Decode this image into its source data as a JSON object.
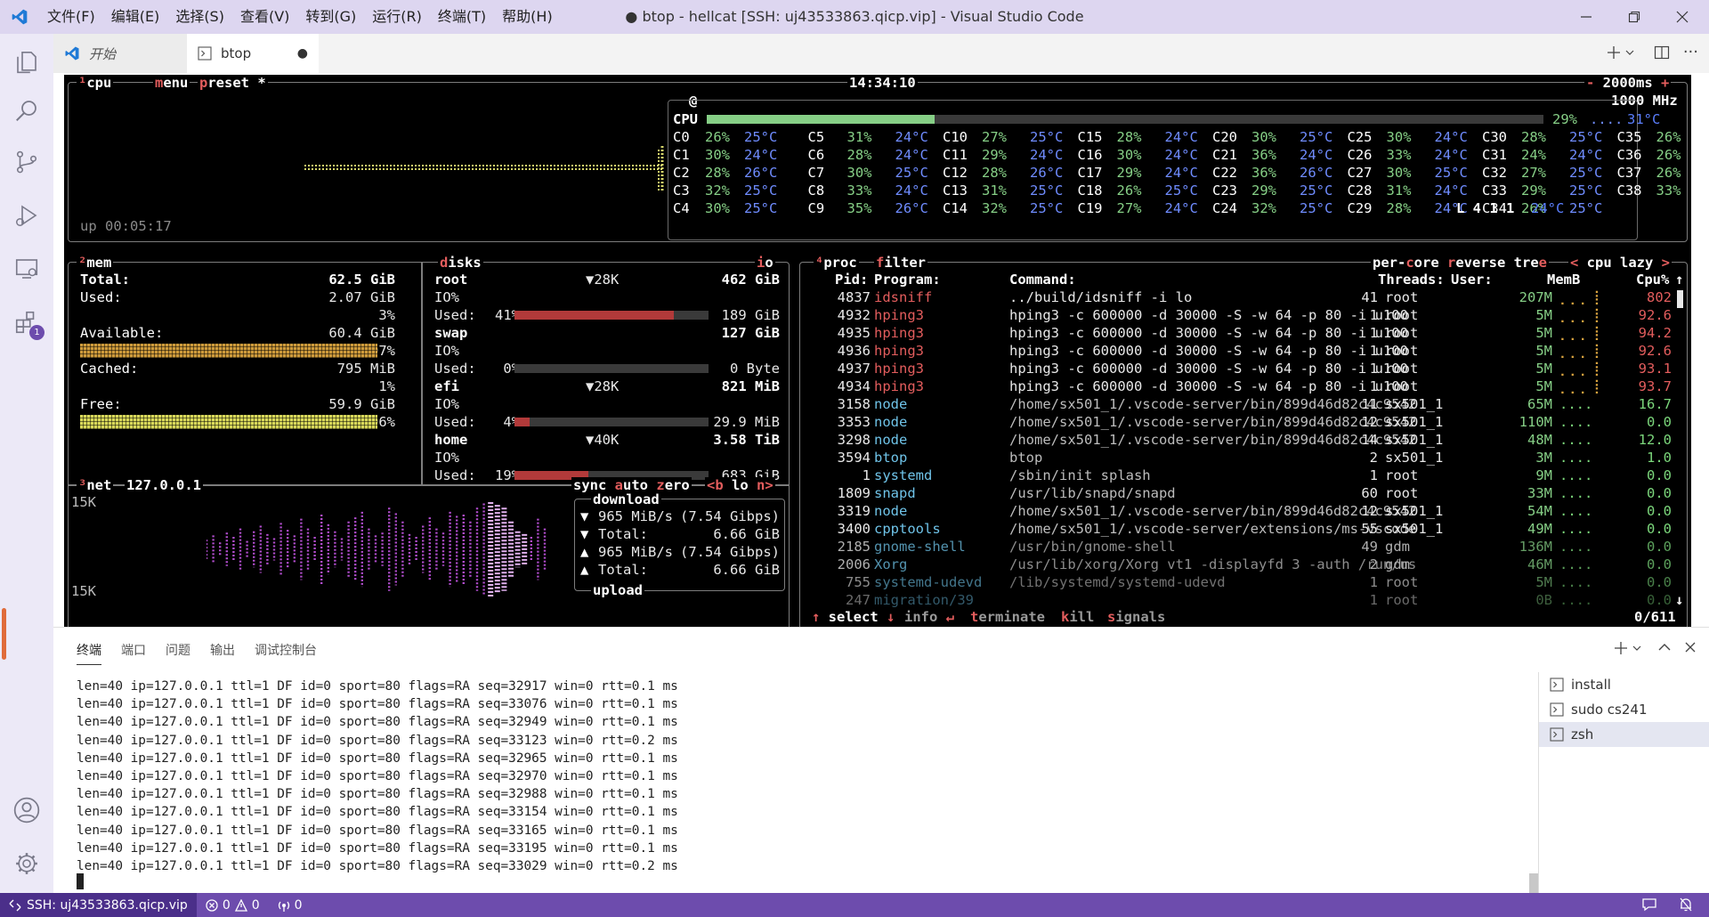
{
  "window": {
    "title": "● btop - hellcat [SSH: uj43533863.qicp.vip] - Visual Studio Code",
    "menu": [
      "文件(F)",
      "编辑(E)",
      "选择(S)",
      "查看(V)",
      "转到(G)",
      "运行(R)",
      "终端(T)",
      "帮助(H)"
    ]
  },
  "tabs": [
    {
      "label": "开始",
      "icon": "vscode-icon"
    },
    {
      "label": "btop",
      "icon": "terminal-icon",
      "dirty": "●"
    }
  ],
  "btop": {
    "cpu": {
      "header_cpu": "cpu",
      "header_cpu_key": "¹",
      "header_menu": "menu",
      "header_preset": "preset *",
      "clock": "14:34:10",
      "interval": "- 2000ms +",
      "freq": "1000 MHz",
      "host_marker": "@",
      "uptime": "up 00:05:17",
      "total_label": "CPU",
      "total_pct": "29%",
      "total_temp": "31°C",
      "total_fill": 0.29,
      "cores_c1": [
        {
          "n": "C0",
          "p": "26%",
          "t": "25°C"
        },
        {
          "n": "C1",
          "p": "30%",
          "t": "24°C"
        },
        {
          "n": "C2",
          "p": "28%",
          "t": "26°C"
        },
        {
          "n": "C3",
          "p": "32%",
          "t": "25°C"
        },
        {
          "n": "C4",
          "p": "30%",
          "t": "25°C"
        }
      ],
      "cores_c2": [
        {
          "n": "C5",
          "p": "31%",
          "t": "24°C"
        },
        {
          "n": "C6",
          "p": "28%",
          "t": "24°C"
        },
        {
          "n": "C7",
          "p": "30%",
          "t": "25°C"
        },
        {
          "n": "C8",
          "p": "33%",
          "t": "24°C"
        },
        {
          "n": "C9",
          "p": "35%",
          "t": "26°C"
        }
      ],
      "cores_c3": [
        {
          "n": "C10",
          "p": "27%",
          "t": "25°C"
        },
        {
          "n": "C11",
          "p": "29%",
          "t": "24°C"
        },
        {
          "n": "C12",
          "p": "28%",
          "t": "26°C"
        },
        {
          "n": "C13",
          "p": "31%",
          "t": "25°C"
        },
        {
          "n": "C14",
          "p": "32%",
          "t": "25°C"
        }
      ],
      "cores_c4": [
        {
          "n": "C15",
          "p": "28%",
          "t": "24°C"
        },
        {
          "n": "C16",
          "p": "30%",
          "t": "24°C"
        },
        {
          "n": "C17",
          "p": "29%",
          "t": "24°C"
        },
        {
          "n": "C18",
          "p": "26%",
          "t": "25°C"
        },
        {
          "n": "C19",
          "p": "27%",
          "t": "24°C"
        }
      ],
      "cores_c5": [
        {
          "n": "C20",
          "p": "30%",
          "t": "25°C"
        },
        {
          "n": "C21",
          "p": "36%",
          "t": "24°C"
        },
        {
          "n": "C22",
          "p": "36%",
          "t": "26°C"
        },
        {
          "n": "C23",
          "p": "29%",
          "t": "25°C"
        },
        {
          "n": "C24",
          "p": "32%",
          "t": "25°C"
        }
      ],
      "cores_c6": [
        {
          "n": "C25",
          "p": "30%",
          "t": "24°C"
        },
        {
          "n": "C26",
          "p": "33%",
          "t": "24°C"
        },
        {
          "n": "C27",
          "p": "30%",
          "t": "25°C"
        },
        {
          "n": "C28",
          "p": "31%",
          "t": "24°C"
        },
        {
          "n": "C29",
          "p": "28%",
          "t": "24°C"
        }
      ],
      "cores_c7": [
        {
          "n": "C30",
          "p": "28%",
          "t": "25°C"
        },
        {
          "n": "C31",
          "p": "24%",
          "t": "24°C"
        },
        {
          "n": "C32",
          "p": "27%",
          "t": "25°C"
        },
        {
          "n": "C33",
          "p": "29%",
          "t": "25°C"
        },
        {
          "n": "C34",
          "p": "26%",
          "t": "25°C"
        }
      ],
      "cores_c8": [
        {
          "n": "C35",
          "p": "26%",
          "t": "24°C"
        },
        {
          "n": "C36",
          "p": "26%",
          "t": "24°C"
        },
        {
          "n": "C37",
          "p": "26%",
          "t": "24°C"
        },
        {
          "n": "C38",
          "p": "33%",
          "t": "25°C"
        },
        {
          "n": "",
          "p": "",
          "t": "24°C"
        }
      ],
      "load_avg": "L 4 1 1"
    },
    "mem": {
      "header": "mem",
      "header_key": "²",
      "rows": [
        {
          "label": "Total:",
          "value": "62.5 GiB"
        },
        {
          "label": "Used:",
          "value": "2.07 GiB"
        },
        {
          "label": "",
          "value": "3%"
        },
        {
          "label": "Available:",
          "value": "60.4 GiB"
        },
        {
          "label": "",
          "value": "97%"
        },
        {
          "label": "Cached:",
          "value": "795 MiB"
        },
        {
          "label": "",
          "value": "1%"
        },
        {
          "label": "Free:",
          "value": "59.9 GiB"
        },
        {
          "label": "",
          "value": "96%"
        }
      ]
    },
    "disks": {
      "header": "disks",
      "io_label": "io",
      "items": [
        {
          "name": "root",
          "io": "▼28K",
          "size": "462 GiB",
          "used_pct": "41%",
          "used_fill": 0.41,
          "used": "189 GiB"
        },
        {
          "name": "swap",
          "io": "",
          "size": "127 GiB",
          "used_pct": "0%",
          "used_fill": 0.0,
          "used": "0 Byte"
        },
        {
          "name": "efi",
          "io": "▼28K",
          "size": "821 MiB",
          "used_pct": "4%",
          "used_fill": 0.04,
          "used": "29.9 MiB"
        },
        {
          "name": "home",
          "io": "▼40K",
          "size": "3.58 TiB",
          "used_pct": "19%",
          "used_fill": 0.19,
          "used": "683 GiB"
        }
      ],
      "io_text": "IO%",
      "used_text": "Used:"
    },
    "net": {
      "header": "net",
      "header_key": "³",
      "iface": "127.0.0.1",
      "opts": [
        "sync",
        "auto",
        "zero"
      ],
      "nav": "<b lo n>",
      "scale_top": "15K",
      "scale_bottom": "15K",
      "download_label": "download",
      "upload_label": "upload",
      "rows": [
        {
          "arrow": "▼",
          "value": "965 MiB/s",
          "extra": "(7.54 Gibps)"
        },
        {
          "arrow": "▼",
          "value": "Total:",
          "extra": "6.66 GiB"
        },
        {
          "arrow": "▲",
          "value": "965 MiB/s",
          "extra": "(7.54 Gibps)"
        },
        {
          "arrow": "▲",
          "value": "Total:",
          "extra": "6.66 GiB"
        }
      ]
    },
    "proc": {
      "header": "proc",
      "header_key": "⁴",
      "filter": "filter",
      "opts": "per-core reverse tree",
      "sort": "< cpu lazy >",
      "columns": {
        "pid": "Pid:",
        "program": "Program:",
        "command": "Command:",
        "threads": "Threads:",
        "user": "User:",
        "mem": "MemB",
        "cpu": "Cpu%"
      },
      "rows": [
        {
          "pid": "4837",
          "program": "idsniff",
          "command": "../build/idsniff -i lo",
          "threads": "41",
          "user": "root",
          "mem": "207M",
          "cpu": "802",
          "hot": true
        },
        {
          "pid": "4932",
          "program": "hping3",
          "command": "hping3 -c 600000 -d 30000 -S -w 64 -p 80 -i u100",
          "threads": "1",
          "user": "root",
          "mem": "5M",
          "cpu": "92.6",
          "hot": true
        },
        {
          "pid": "4935",
          "program": "hping3",
          "command": "hping3 -c 600000 -d 30000 -S -w 64 -p 80 -i u100",
          "threads": "1",
          "user": "root",
          "mem": "5M",
          "cpu": "94.2",
          "hot": true
        },
        {
          "pid": "4936",
          "program": "hping3",
          "command": "hping3 -c 600000 -d 30000 -S -w 64 -p 80 -i u100",
          "threads": "1",
          "user": "root",
          "mem": "5M",
          "cpu": "92.6",
          "hot": true
        },
        {
          "pid": "4937",
          "program": "hping3",
          "command": "hping3 -c 600000 -d 30000 -S -w 64 -p 80 -i u100",
          "threads": "1",
          "user": "root",
          "mem": "5M",
          "cpu": "93.1",
          "hot": true
        },
        {
          "pid": "4934",
          "program": "hping3",
          "command": "hping3 -c 600000 -d 30000 -S -w 64 -p 80 -i u100",
          "threads": "1",
          "user": "root",
          "mem": "5M",
          "cpu": "93.7",
          "hot": true
        },
        {
          "pid": "3158",
          "program": "node",
          "command": "/home/sx501_1/.vscode-server/bin/899d46d82c4c9542",
          "threads": "11",
          "user": "sx501_1",
          "mem": "65M",
          "cpu": "16.7",
          "hot": false
        },
        {
          "pid": "3353",
          "program": "node",
          "command": "/home/sx501_1/.vscode-server/bin/899d46d82c4c9542",
          "threads": "12",
          "user": "sx501_1",
          "mem": "110M",
          "cpu": "0.0",
          "hot": false
        },
        {
          "pid": "3298",
          "program": "node",
          "command": "/home/sx501_1/.vscode-server/bin/899d46d82c4c9542",
          "threads": "14",
          "user": "sx501_1",
          "mem": "48M",
          "cpu": "12.0",
          "hot": false
        },
        {
          "pid": "3594",
          "program": "btop",
          "command": "btop",
          "threads": "2",
          "user": "sx501_1",
          "mem": "3M",
          "cpu": "1.0",
          "hot": false
        },
        {
          "pid": "1",
          "program": "systemd",
          "command": "/sbin/init splash",
          "threads": "1",
          "user": "root",
          "mem": "9M",
          "cpu": "0.0",
          "hot": false
        },
        {
          "pid": "1809",
          "program": "snapd",
          "command": "/usr/lib/snapd/snapd",
          "threads": "60",
          "user": "root",
          "mem": "33M",
          "cpu": "0.0",
          "hot": false
        },
        {
          "pid": "3319",
          "program": "node",
          "command": "/home/sx501_1/.vscode-server/bin/899d46d82c4c9542",
          "threads": "12",
          "user": "sx501_1",
          "mem": "54M",
          "cpu": "0.0",
          "hot": false
        },
        {
          "pid": "3400",
          "program": "cpptools",
          "command": "/home/sx501_1/.vscode-server/extensions/ms-vscode",
          "threads": "55",
          "user": "sx501_1",
          "mem": "49M",
          "cpu": "0.0",
          "hot": false
        },
        {
          "pid": "2185",
          "program": "gnome-shell",
          "command": "/usr/bin/gnome-shell",
          "threads": "49",
          "user": "gdm",
          "mem": "136M",
          "cpu": "0.0",
          "hot": false
        },
        {
          "pid": "2006",
          "program": "Xorg",
          "command": "/usr/lib/xorg/Xorg vt1 -displayfd 3 -auth /run/us",
          "threads": "2",
          "user": "gdm",
          "mem": "46M",
          "cpu": "0.0",
          "hot": false
        },
        {
          "pid": "755",
          "program": "systemd-udevd",
          "command": "/lib/systemd/systemd-udevd",
          "threads": "1",
          "user": "root",
          "mem": "5M",
          "cpu": "0.0",
          "hot": false
        },
        {
          "pid": "247",
          "program": "migration/39",
          "command": "",
          "threads": "1",
          "user": "root",
          "mem": "0B",
          "cpu": "0.0",
          "hot": false
        }
      ],
      "footer": [
        "↑ select ↓",
        "info ↵",
        "terminate",
        "kill",
        "signals"
      ],
      "count": "0/611"
    }
  },
  "panel": {
    "tabs": [
      "终端",
      "端口",
      "问题",
      "输出",
      "调试控制台"
    ],
    "active_tab": "终端",
    "lines": [
      "len=40 ip=127.0.0.1 ttl=1 DF id=0 sport=80 flags=RA seq=32917 win=0 rtt=0.1 ms",
      "len=40 ip=127.0.0.1 ttl=1 DF id=0 sport=80 flags=RA seq=33076 win=0 rtt=0.1 ms",
      "len=40 ip=127.0.0.1 ttl=1 DF id=0 sport=80 flags=RA seq=32949 win=0 rtt=0.1 ms",
      "len=40 ip=127.0.0.1 ttl=1 DF id=0 sport=80 flags=RA seq=33123 win=0 rtt=0.2 ms",
      "len=40 ip=127.0.0.1 ttl=1 DF id=0 sport=80 flags=RA seq=32965 win=0 rtt=0.1 ms",
      "len=40 ip=127.0.0.1 ttl=1 DF id=0 sport=80 flags=RA seq=32970 win=0 rtt=0.1 ms",
      "len=40 ip=127.0.0.1 ttl=1 DF id=0 sport=80 flags=RA seq=32988 win=0 rtt=0.1 ms",
      "len=40 ip=127.0.0.1 ttl=1 DF id=0 sport=80 flags=RA seq=33154 win=0 rtt=0.1 ms",
      "len=40 ip=127.0.0.1 ttl=1 DF id=0 sport=80 flags=RA seq=33165 win=0 rtt=0.1 ms",
      "len=40 ip=127.0.0.1 ttl=1 DF id=0 sport=80 flags=RA seq=33195 win=0 rtt=0.1 ms",
      "len=40 ip=127.0.0.1 ttl=1 DF id=0 sport=80 flags=RA seq=33029 win=0 rtt=0.2 ms"
    ],
    "terminals": [
      {
        "label": "install",
        "selected": false
      },
      {
        "label": "sudo  cs241",
        "selected": false
      },
      {
        "label": "zsh",
        "selected": true
      }
    ]
  },
  "status": {
    "remote": "SSH: uj43533863.qicp.vip",
    "errors": "0",
    "warnings": "0",
    "ports": "0"
  },
  "colors": {
    "accent": "#6d4cad",
    "titlebar": "#ddd6f0",
    "proc_hot": "#e35d5d",
    "proc_name": "#6fc3e8",
    "net_graph": "#c85ad8"
  }
}
